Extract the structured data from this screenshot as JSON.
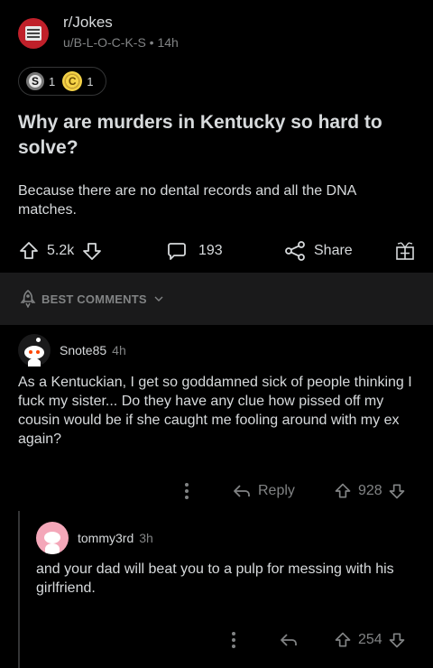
{
  "post": {
    "subreddit": "r/Jokes",
    "user_line": "u/B-L-O-C-K-S • 14h",
    "awards": [
      {
        "icon": "silver-award-icon",
        "letter": "S",
        "count": "1"
      },
      {
        "icon": "gold-award-icon",
        "letter": "C",
        "count": "1"
      }
    ],
    "title": "Why are murders in Kentucky so hard to solve?",
    "body": "Because there are no dental records and all the DNA matches.",
    "score": "5.2k",
    "comments": "193",
    "share_label": "Share"
  },
  "sort": {
    "label": "BEST COMMENTS"
  },
  "comments": [
    {
      "author": "Snote85",
      "age": "4h",
      "text": "As a Kentuckian, I get so goddamned sick of people thinking I fuck my sister... Do they have any clue how pissed off my cousin would be if she caught me fooling around with my ex again?",
      "reply_label": "Reply",
      "score": "928"
    },
    {
      "author": "tommy3rd",
      "age": "3h",
      "text": "and your dad will beat you to a pulp for messing with his girlfriend.",
      "score": "254"
    }
  ],
  "colors": {
    "background": "#000000",
    "bar": "#1a1a1b",
    "text": "#d7dadc",
    "muted": "#818384",
    "award_gold": "#f5d347"
  }
}
